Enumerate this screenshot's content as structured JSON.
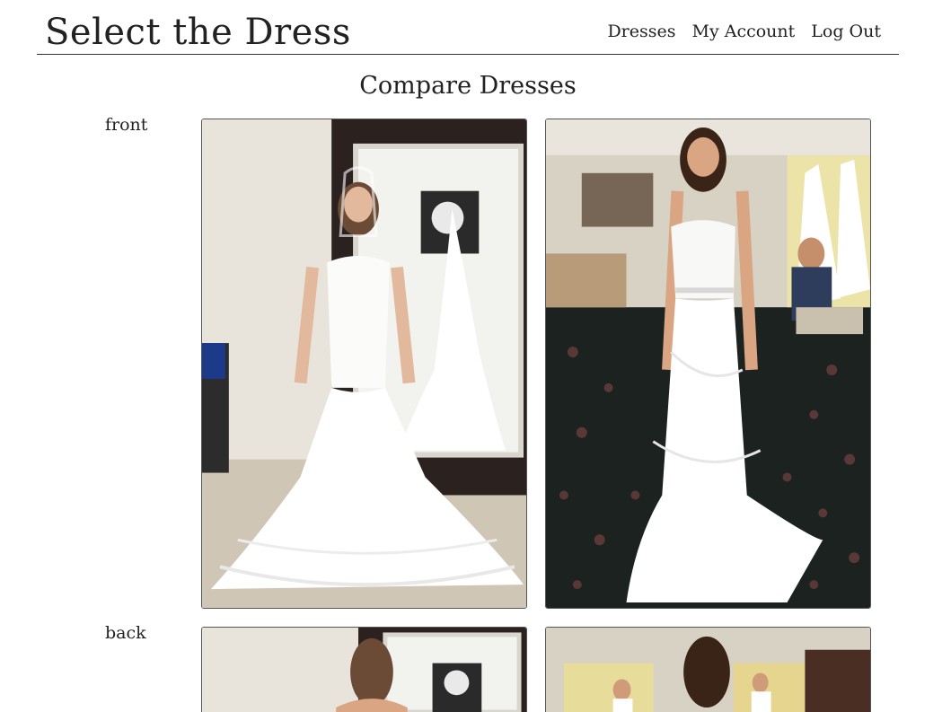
{
  "header": {
    "site_title": "Select the Dress",
    "nav": {
      "dresses": "Dresses",
      "my_account": "My Account",
      "log_out": "Log Out"
    }
  },
  "main": {
    "page_title": "Compare Dresses",
    "rows": [
      {
        "label": "front"
      },
      {
        "label": "back"
      }
    ]
  },
  "colors": {
    "text": "#222222",
    "divider": "#333333",
    "background": "#ffffff"
  }
}
